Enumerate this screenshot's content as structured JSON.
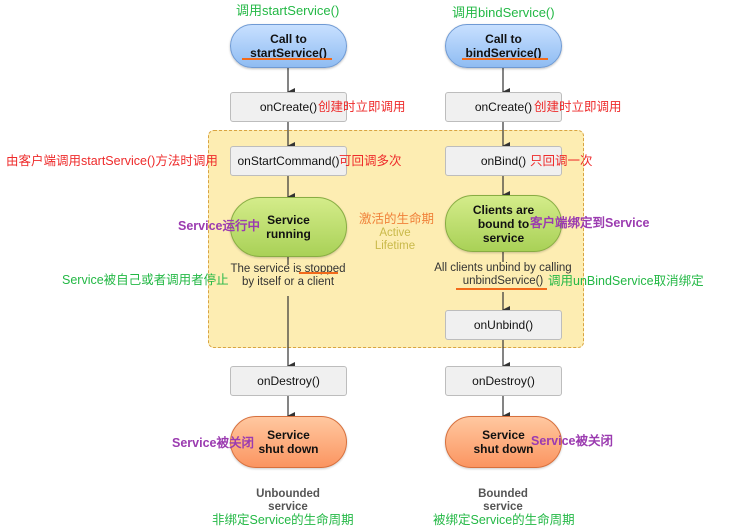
{
  "left_flow": {
    "top_note": "调用startService()",
    "start_pill": {
      "line1": "Call to",
      "line2": "startService()"
    },
    "oncreate": {
      "label": "onCreate()",
      "note": "创建时立即调用"
    },
    "onstartcommand": {
      "label": "onStartCommand()",
      "note": "可回调多次",
      "left_note": "由客户端调用startService()方法时调用"
    },
    "running_pill": {
      "line1": "Service",
      "line2": "running",
      "note": "Service运行中"
    },
    "stopped_text": {
      "line1": "The service is stopped",
      "line2": "by itself or a client",
      "note": "Service被自己或者调用者停止"
    },
    "ondestroy": {
      "label": "onDestroy()"
    },
    "shutdown_pill": {
      "line1": "Service",
      "line2": "shut down",
      "note": "Service被关闭"
    },
    "footer": {
      "line1": "Unbounded",
      "line2": "service",
      "note": "非绑定Service的生命周期"
    }
  },
  "right_flow": {
    "top_note": "调用bindService()",
    "start_pill": {
      "line1": "Call to",
      "line2": "bindService()"
    },
    "oncreate": {
      "label": "onCreate()",
      "note": "创建时立即调用"
    },
    "onbind": {
      "label": "onBind()",
      "note": "只回调一次"
    },
    "bound_pill": {
      "line1": "Clients are",
      "line2": "bound to",
      "line3": "service",
      "note": "客户端绑定到Service"
    },
    "unbind_text": {
      "line1": "All clients unbind by calling",
      "line2": "unbindService()",
      "note": "调用unBindService取消绑定"
    },
    "onunbind": {
      "label": "onUnbind()"
    },
    "ondestroy": {
      "label": "onDestroy()"
    },
    "shutdown_pill": {
      "line1": "Service",
      "line2": "shut down",
      "note": "Service被关闭"
    },
    "footer": {
      "line1": "Bounded",
      "line2": "service",
      "note": "被绑定Service的生命周期"
    }
  },
  "active_lifetime": {
    "cn": "激活的生命期",
    "line1": "Active",
    "line2": "Lifetime"
  },
  "colors": {
    "active_zone": "#fdedb2",
    "blue_pill": "#a9cdf8",
    "green_pill": "#bfe06f",
    "orange_pill": "#fdac7c",
    "red_note": "#ee2b2b",
    "green_note": "#23b845",
    "purple_note": "#9b3bb0",
    "underline": "#f26a1b"
  }
}
